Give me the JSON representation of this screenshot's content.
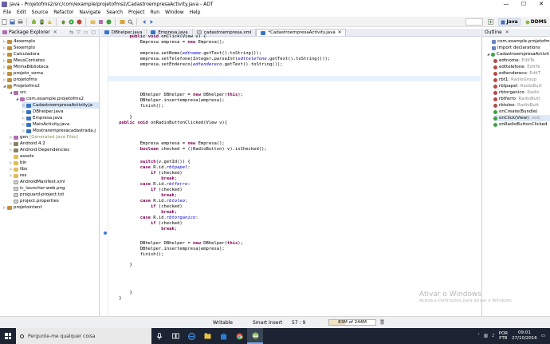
{
  "window": {
    "title": "Java - Projetofms2/src/com/example/projetofms2/CadastroempresaActivity.java - ADT",
    "minimize": "—",
    "maximize": "☐",
    "close": "✕"
  },
  "menu": [
    "File",
    "Edit",
    "Source",
    "Refactor",
    "Navigate",
    "Search",
    "Project",
    "Run",
    "Window",
    "Help"
  ],
  "perspectives": {
    "java": "Java",
    "ddms": "DDMS"
  },
  "package_explorer": {
    "title": "Package Explorer",
    "items": [
      {
        "label": "4exemplo",
        "icon": "project-icon"
      },
      {
        "label": "5exemplo",
        "icon": "project-icon"
      },
      {
        "label": "Calculadora",
        "icon": "project-icon"
      },
      {
        "label": "MeusContatos",
        "icon": "project-icon"
      },
      {
        "label": "MinhaBiblioteca",
        "icon": "project-icon"
      },
      {
        "label": "projeto_soma",
        "icon": "project-icon"
      },
      {
        "label": "projetofms",
        "icon": "project-icon"
      },
      {
        "label": "Projetofms2",
        "icon": "project-icon"
      },
      {
        "label": "src",
        "icon": "source-folder-icon"
      },
      {
        "label": "com.example.projetofms2",
        "icon": "package-icon"
      },
      {
        "label": "CadastroempresaActivity.ja",
        "icon": "java-file-icon"
      },
      {
        "label": "DBhelper.java",
        "icon": "java-file-icon"
      },
      {
        "label": "Empresa.java",
        "icon": "java-file-icon"
      },
      {
        "label": "MainActivity.java",
        "icon": "java-file-icon"
      },
      {
        "label": "Mostrarempresacadastrada.j",
        "icon": "java-file-icon"
      },
      {
        "label": "gen",
        "suffix": "[Generated Java Files]",
        "icon": "source-folder-icon"
      },
      {
        "label": "Android 4.2",
        "icon": "library-icon"
      },
      {
        "label": "Android Dependencies",
        "icon": "library-icon"
      },
      {
        "label": "assets",
        "icon": "folder-icon"
      },
      {
        "label": "bin",
        "icon": "folder-icon"
      },
      {
        "label": "libs",
        "icon": "folder-icon"
      },
      {
        "label": "res",
        "icon": "folder-icon"
      },
      {
        "label": "AndroidManifest.xml",
        "icon": "file-icon"
      },
      {
        "label": "ic_launcher-web.png",
        "icon": "file-icon"
      },
      {
        "label": "proguard-project.txt",
        "icon": "file-icon"
      },
      {
        "label": "project.properties",
        "icon": "file-icon"
      },
      {
        "label": "projetointent",
        "icon": "project-icon"
      }
    ]
  },
  "editor": {
    "tabs": [
      "DBhelper.java",
      "Empresa.java",
      "cadastroempresa.xml",
      "*CadastroempresaActivity.java"
    ],
    "active_tab": 3
  },
  "outline": {
    "title": "Outline",
    "items": [
      {
        "label": "com.example.projetofm",
        "type": ""
      },
      {
        "label": "import declarations",
        "type": ""
      },
      {
        "label": "CadastroempresaActivit",
        "type": ""
      },
      {
        "label": "edtnome",
        "type": " : EditTe"
      },
      {
        "label": "edttelefone",
        "type": " : EditTe"
      },
      {
        "label": "edtendereco",
        "type": " : EditT"
      },
      {
        "label": "rbt1",
        "type": " : RadioGroup"
      },
      {
        "label": "rbtpapel",
        "type": " : RadioButt"
      },
      {
        "label": "rbtorganico",
        "type": " : Radio"
      },
      {
        "label": "rbtferro",
        "type": " : RadioButt"
      },
      {
        "label": "rbtoleo",
        "type": " : RadioButt"
      },
      {
        "label": "onCreate(Bundle)",
        "type": ""
      },
      {
        "label": "onClick(View)",
        "type": " : voic"
      },
      {
        "label": "onRadioButtonClicked",
        "type": ""
      }
    ]
  },
  "status": {
    "writable": "Writable",
    "insert_mode": "Smart Insert",
    "position": "57 : 9",
    "memory": "83M of 244M",
    "memory_fraction": 0.34
  },
  "watermark": {
    "line1": "Ativar o Windows",
    "line2": "Aceda a Definições para ativar o Windows."
  },
  "taskbar": {
    "search_placeholder": "Pergunte-me qualquer coisa",
    "lang1": "POR",
    "lang2": "PTB",
    "time": "09:01",
    "date": "27/10/2016"
  }
}
